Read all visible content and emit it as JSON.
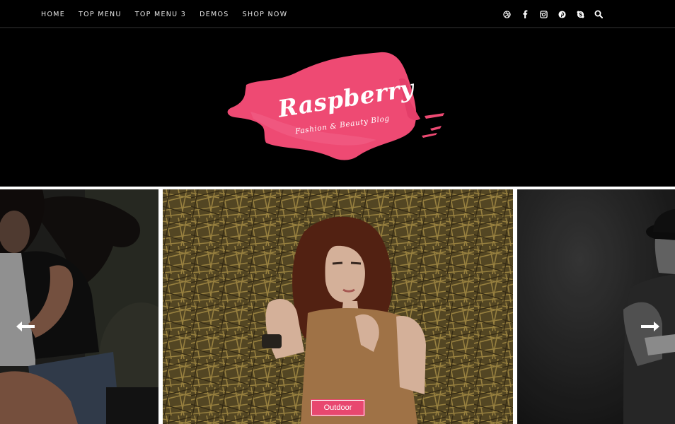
{
  "nav": {
    "items": [
      {
        "label": "HOME"
      },
      {
        "label": "TOP MENU"
      },
      {
        "label": "TOP MENU 3"
      },
      {
        "label": "DEMOS"
      },
      {
        "label": "SHOP NOW"
      }
    ]
  },
  "social": {
    "icons": [
      "dribbble-icon",
      "facebook-icon",
      "instagram-icon",
      "pinterest-icon",
      "skype-icon",
      "search-icon"
    ]
  },
  "logo": {
    "title": "Raspberry",
    "subtitle": "Fashion & Beauty Blog",
    "brand_color": "#ee4a73"
  },
  "slider": {
    "category_label": "Outdoor",
    "prev_icon": "arrow-left-icon",
    "next_icon": "arrow-right-icon",
    "accent": "#e8476f"
  }
}
